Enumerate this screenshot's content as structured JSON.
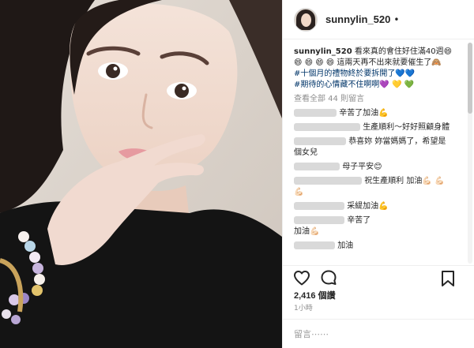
{
  "post": {
    "username": "sunnylin_520",
    "separator": "•",
    "caption": {
      "user": "sunnylin_520",
      "line1": "看來真的會住好住滿40週😄",
      "line2": "😄 😄 😄 😄 這兩天再不出來就要催生了🙈",
      "line3": "#十個月的禮物終於要拆開了💙💙",
      "line4": "#期待的心情藏不住啊啊💜 💛 💚"
    },
    "view_all": "查看全部 44 則留言",
    "comments": [
      {
        "text": "辛苦了加油💪"
      },
      {
        "text": "生產順利～好好照顧身體"
      },
      {
        "text": "恭喜妳 妳當媽媽了，希望是"
      },
      {
        "text": "個女兒"
      },
      {
        "text": "母子平安😊"
      },
      {
        "text": "祝生產順利 加油💪🏻 💪🏻"
      },
      {
        "text": "💪🏻"
      },
      {
        "text": "采緹加油💪"
      },
      {
        "text": "辛苦了"
      },
      {
        "text": "加油💪🏻"
      },
      {
        "text": "加油"
      }
    ],
    "likes": "2,416 個讚",
    "timestamp": "1小時",
    "add_comment_placeholder": "留言⋯⋯"
  },
  "icons": {
    "like": "heart-icon",
    "comment": "comment-bubble-icon",
    "save": "bookmark-icon"
  },
  "colors": {
    "hashtag": "#003569",
    "text": "#262626",
    "muted": "#8e8e8e",
    "border": "#efefef"
  }
}
